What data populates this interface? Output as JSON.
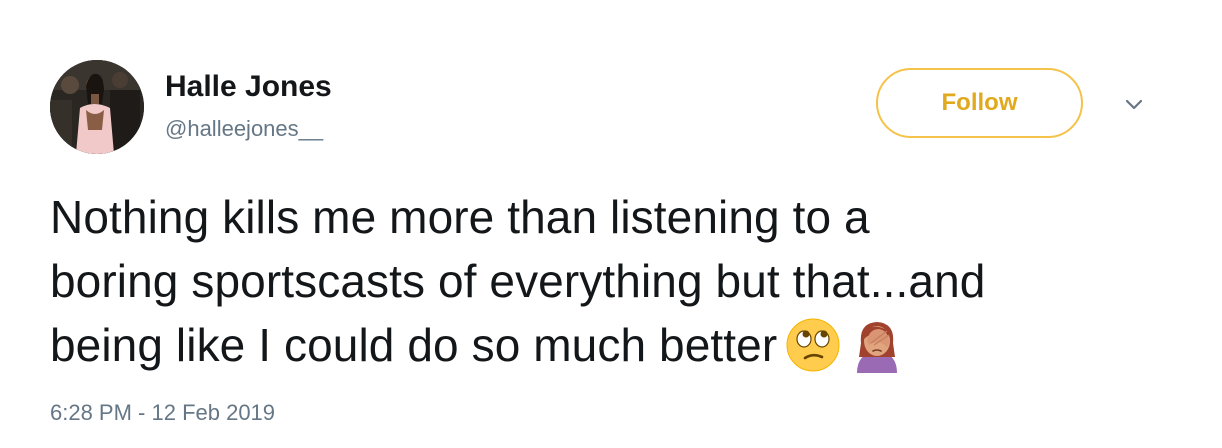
{
  "user": {
    "display_name": "Halle Jones",
    "handle": "@halleejones__"
  },
  "actions": {
    "follow_label": "Follow",
    "menu_icon": "chevron-down-icon"
  },
  "tweet": {
    "lines": [
      "Nothing kills me more than listening to a",
      "boring sportscasts of everything but that...and",
      "being like I could do so much better"
    ],
    "emojis": [
      "face-with-rolling-eyes-emoji",
      "woman-facepalming-emoji"
    ],
    "timestamp": "6:28 PM - 12 Feb 2019"
  },
  "colors": {
    "follow_border": "#f5c24a",
    "follow_text": "#e1a91e",
    "secondary_text": "#657786",
    "primary_text": "#14171a"
  }
}
